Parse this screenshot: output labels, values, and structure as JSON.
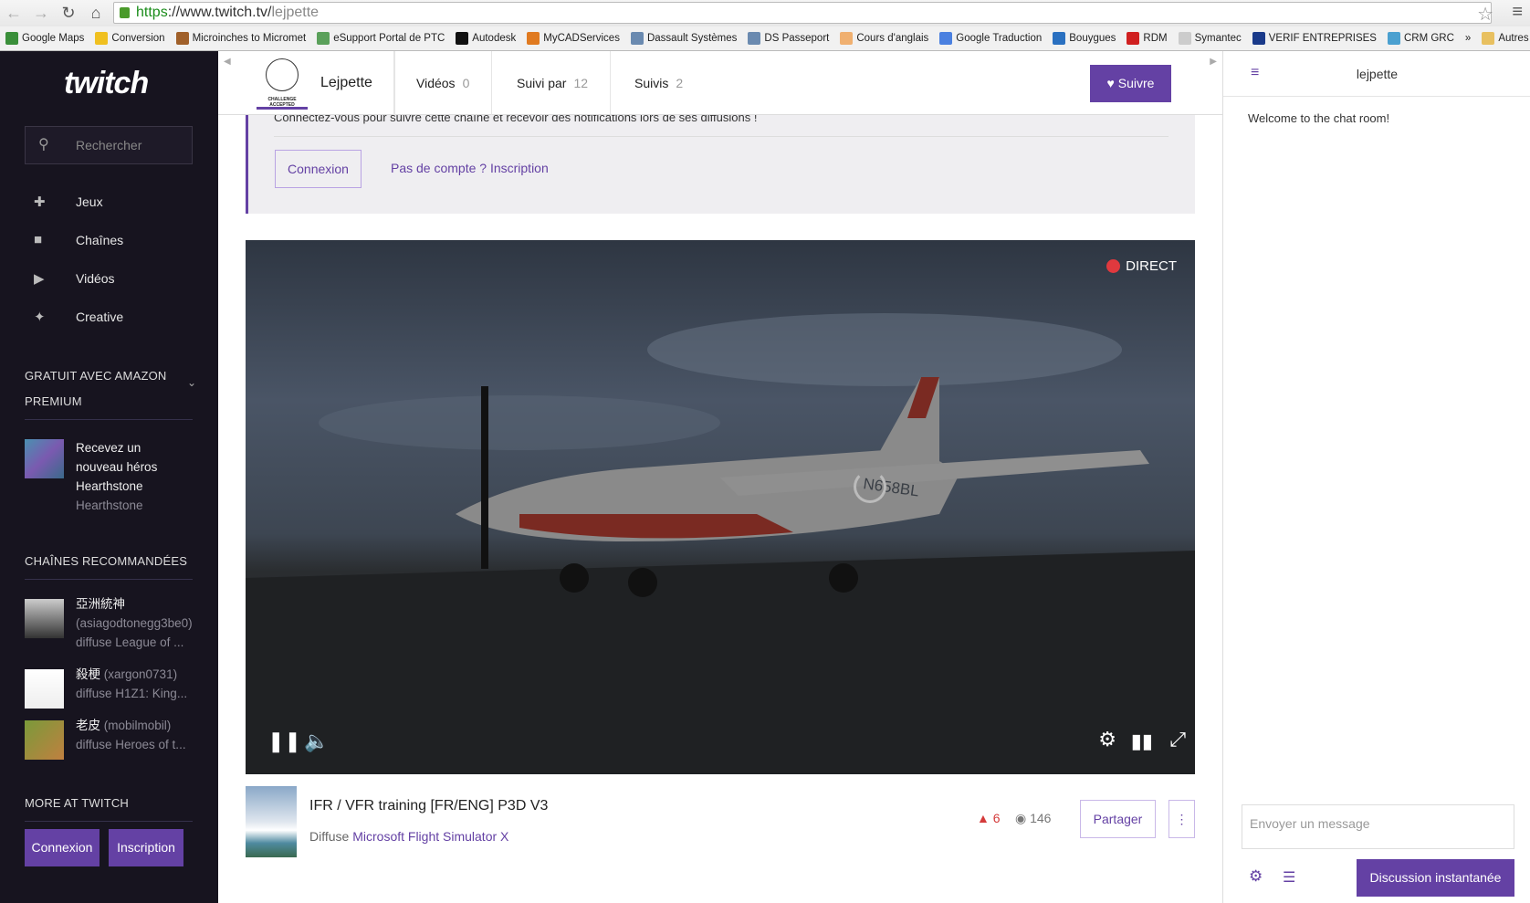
{
  "browser": {
    "url_scheme": "https",
    "url_host": "://www.twitch.tv/",
    "url_path": "lejpette",
    "bookmarks": [
      {
        "label": "Google Maps",
        "color": "#3a8f3a"
      },
      {
        "label": "Conversion",
        "color": "#f0c020"
      },
      {
        "label": "Microinches to Micromet",
        "color": "#a0602a"
      },
      {
        "label": "eSupport Portal de PTC",
        "color": "#5aa05a"
      },
      {
        "label": "Autodesk",
        "color": "#111111"
      },
      {
        "label": "MyCADServices",
        "color": "#e07a20"
      },
      {
        "label": "Dassault Systèmes",
        "color": "#6a8ab0"
      },
      {
        "label": "DS Passeport",
        "color": "#6a8ab0"
      },
      {
        "label": "Cours d'anglais",
        "color": "#f0b070"
      },
      {
        "label": "Google Traduction",
        "color": "#4a80e0"
      },
      {
        "label": "Bouygues",
        "color": "#2a70c0"
      },
      {
        "label": "RDM",
        "color": "#d02020"
      },
      {
        "label": "Symantec",
        "color": "#cccccc"
      },
      {
        "label": "VERIF ENTREPRISES",
        "color": "#1a3a8a"
      },
      {
        "label": "CRM GRC",
        "color": "#4aa0d0"
      }
    ],
    "overflow": "»",
    "other_bookmarks": "Autres favoris"
  },
  "sidebar": {
    "logo": "twitch",
    "search_placeholder": "Rechercher",
    "nav": [
      {
        "label": "Jeux",
        "icon": "gamepad-icon"
      },
      {
        "label": "Chaînes",
        "icon": "camera-icon"
      },
      {
        "label": "Vidéos",
        "icon": "play-icon"
      },
      {
        "label": "Creative",
        "icon": "sparkle-icon"
      }
    ],
    "amazon": {
      "heading1": "GRATUIT AVEC AMAZON",
      "heading2": "PREMIUM",
      "offer_lines": [
        "Recevez un",
        "nouveau héros",
        "Hearthstone"
      ],
      "offer_game": "Hearthstone"
    },
    "recommended": {
      "heading": "CHAÎNES RECOMMANDÉES",
      "channels": [
        {
          "name": "亞洲統神",
          "login": "(asiagodtonegg3be0)",
          "game": "diffuse League of ..."
        },
        {
          "name": "殺梗",
          "login": "(xargon0731)",
          "game": "diffuse H1Z1: King..."
        },
        {
          "name": "老皮",
          "login": "(mobilmobil)",
          "game": "diffuse Heroes of t..."
        }
      ]
    },
    "more": {
      "heading": "MORE AT TWITCH",
      "login": "Connexion",
      "signup": "Inscription"
    }
  },
  "channel": {
    "avatar_text": "CHALLENGE ACCEPTED",
    "name": "Lejpette",
    "tabs": [
      {
        "label": "Vidéos",
        "count": "0"
      },
      {
        "label": "Suivi par",
        "count": "12"
      },
      {
        "label": "Suivis",
        "count": "2"
      }
    ],
    "follow": "Suivre"
  },
  "notice": {
    "text": "Connectez-vous pour suivre cette chaîne et recevoir des notifications lors de ses diffusions !",
    "login": "Connexion",
    "signup": "Pas de compte ? Inscription"
  },
  "player": {
    "live": "DIRECT",
    "tail": "N658BL"
  },
  "stream": {
    "title": "IFR / VFR training [FR/ENG] P3D V3",
    "prefix": "Diffuse",
    "game": "Microsoft Flight Simulator X",
    "followers": "6",
    "viewers": "146",
    "share": "Partager",
    "more": "⋮"
  },
  "chat": {
    "title": "lejpette",
    "welcome": "Welcome to the chat room!",
    "placeholder": "Envoyer un message",
    "send": "Discussion instantanée"
  },
  "colors": {
    "accent": "#6441a4",
    "sidebar": "#17141f",
    "live": "#e0393e"
  }
}
